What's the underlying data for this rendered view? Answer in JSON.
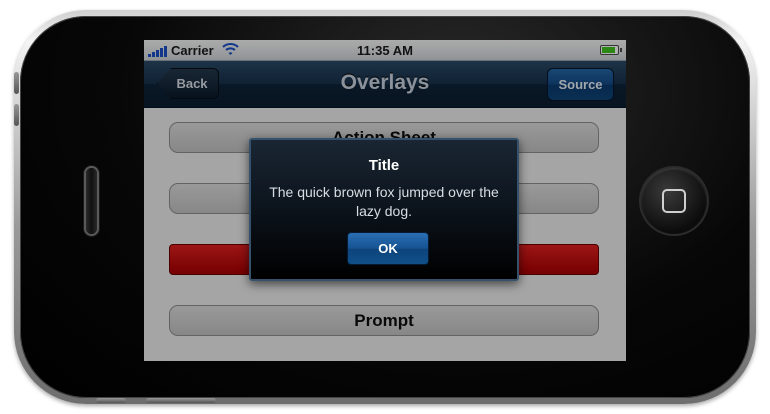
{
  "status_bar": {
    "carrier": "Carrier",
    "time": "11:35 AM",
    "battery_level": 1.0
  },
  "nav_bar": {
    "back_label": "Back",
    "title": "Overlays",
    "source_label": "Source"
  },
  "list": {
    "items": [
      {
        "label": "Action Sheet",
        "style": "gray"
      },
      {
        "label": "",
        "style": "gray"
      },
      {
        "label": "",
        "style": "red"
      },
      {
        "label": "Prompt",
        "style": "gray"
      }
    ]
  },
  "alert": {
    "title": "Title",
    "message": "The quick brown fox jumped over the lazy dog.",
    "ok_label": "OK"
  },
  "colors": {
    "nav_bar": "#0e2338",
    "accent_button": "#165393",
    "destructive": "#c00000",
    "battery": "#40c21e"
  }
}
